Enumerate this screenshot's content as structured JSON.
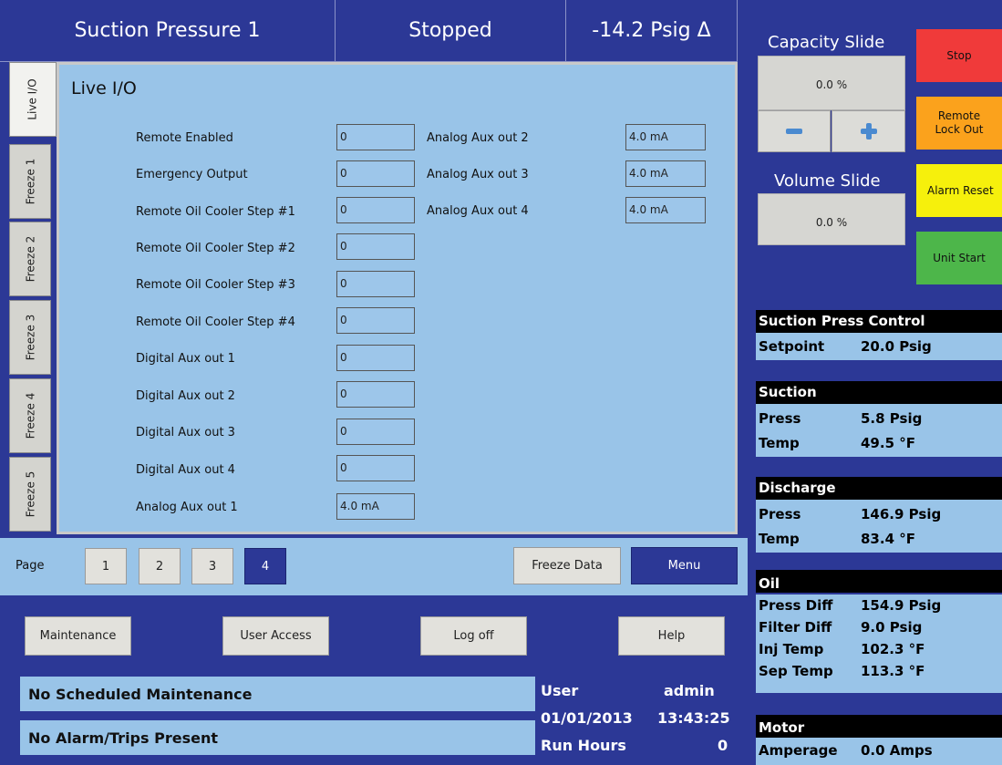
{
  "header": {
    "title": "Suction Pressure 1",
    "state": "Stopped",
    "value": "-14.2 Psig Δ"
  },
  "tabs": [
    "Live I/O",
    "Freeze 1",
    "Freeze 2",
    "Freeze 3",
    "Freeze 4",
    "Freeze 5"
  ],
  "panel": {
    "title": "Live I/O",
    "left_rows": [
      {
        "label": "Remote Enabled",
        "value": "0"
      },
      {
        "label": "Emergency Output",
        "value": "0"
      },
      {
        "label": "Remote Oil Cooler Step #1",
        "value": "0"
      },
      {
        "label": "Remote Oil Cooler Step #2",
        "value": "0"
      },
      {
        "label": "Remote Oil Cooler Step #3",
        "value": "0"
      },
      {
        "label": "Remote Oil Cooler Step #4",
        "value": "0"
      },
      {
        "label": "Digital Aux out 1",
        "value": "0"
      },
      {
        "label": "Digital Aux out 2",
        "value": "0"
      },
      {
        "label": "Digital Aux out 3",
        "value": "0"
      },
      {
        "label": "Digital Aux out 4",
        "value": "0"
      },
      {
        "label": "Analog Aux out 1",
        "value": "4.0 mA"
      }
    ],
    "right_rows": [
      {
        "label": "Analog Aux out 2",
        "value": "4.0 mA"
      },
      {
        "label": "Analog Aux out 3",
        "value": "4.0 mA"
      },
      {
        "label": "Analog Aux out 4",
        "value": "4.0 mA"
      }
    ]
  },
  "pager": {
    "label": "Page",
    "pages": [
      "1",
      "2",
      "3",
      "4"
    ],
    "current": "4",
    "freeze_label": "Freeze Data",
    "menu_label": "Menu"
  },
  "bottom_buttons": [
    "Maintenance",
    "User Access",
    "Log off",
    "Help"
  ],
  "status": {
    "maintenance": "No Scheduled Maintenance",
    "alarms": "No Alarm/Trips Present"
  },
  "user": {
    "label": "User",
    "name": "admin",
    "date": "01/01/2013",
    "time": "13:43:25",
    "run_hours_label": "Run Hours",
    "run_hours": "0"
  },
  "capacity": {
    "title": "Capacity Slide",
    "value": "0.0 %"
  },
  "volume": {
    "title": "Volume Slide",
    "value": "0.0 %"
  },
  "controls": {
    "stop": "Stop",
    "remote_lockout": "Remote\nLock Out",
    "alarm_reset": "Alarm Reset",
    "unit_start": "Unit Start"
  },
  "colors": {
    "stop": "#f03a3a",
    "lockout": "#fba21c",
    "alarm_reset": "#f6f00c",
    "unit_start": "#4db64a",
    "background": "#2c3896",
    "panel": "#99c4e8"
  },
  "sections": [
    {
      "title": "Suction Press Control",
      "rows": [
        {
          "k": "Setpoint",
          "v": "20.0 Psig"
        }
      ]
    },
    {
      "title": "Suction",
      "rows": [
        {
          "k": "Press",
          "v": "5.8 Psig"
        },
        {
          "k": "Temp",
          "v": "49.5 °F"
        }
      ]
    },
    {
      "title": "Discharge",
      "rows": [
        {
          "k": "Press",
          "v": "146.9 Psig"
        },
        {
          "k": "Temp",
          "v": "83.4 °F"
        }
      ]
    },
    {
      "title": "Oil",
      "rows": [
        {
          "k": "Press Diff",
          "v": "154.9 Psig"
        },
        {
          "k": "Filter Diff",
          "v": "9.0 Psig"
        },
        {
          "k": "Inj Temp",
          "v": "102.3 °F"
        },
        {
          "k": "Sep Temp",
          "v": "113.3 °F"
        }
      ]
    },
    {
      "title": "Motor",
      "rows": [
        {
          "k": "Amperage",
          "v": "0.0 Amps"
        }
      ]
    }
  ]
}
